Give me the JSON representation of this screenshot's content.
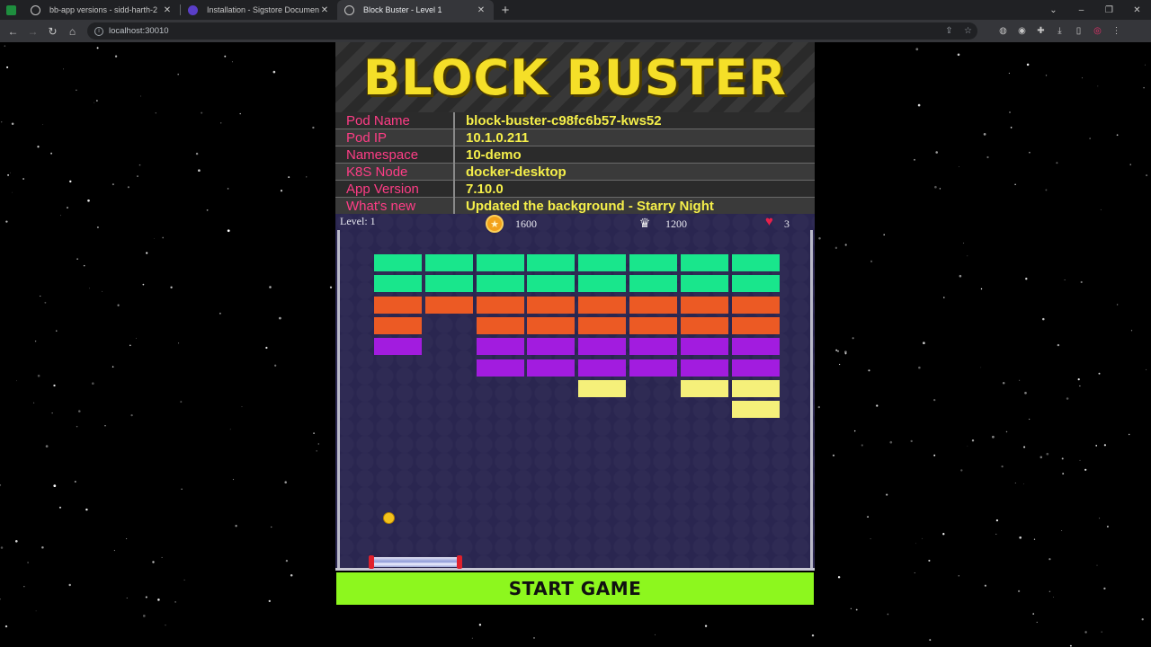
{
  "browser": {
    "tabs": [
      {
        "title": "bb-app versions - sidd-harth-2",
        "icon": "github-icon",
        "active": false
      },
      {
        "title": "Installation - Sigstore Document",
        "icon": "sigstore-icon",
        "active": false
      },
      {
        "title": "Block Buster - Level 1",
        "icon": "globe-icon",
        "active": true
      }
    ],
    "url": "localhost:30010"
  },
  "game": {
    "title": "BLOCK BUSTER",
    "info": [
      {
        "key": "Pod Name",
        "value": "block-buster-c98fc6b57-kws52"
      },
      {
        "key": "Pod IP",
        "value": "10.1.0.211"
      },
      {
        "key": "Namespace",
        "value": "10-demo"
      },
      {
        "key": "K8S Node",
        "value": "docker-desktop"
      },
      {
        "key": "App Version",
        "value": "7.10.0"
      },
      {
        "key": "What's new",
        "value": "Updated the background - Starry Night"
      }
    ],
    "hud": {
      "level": "Level: 1",
      "score": "1600",
      "hiscore": "1200",
      "lives": "3"
    },
    "start_label": "START GAME",
    "colors": {
      "green": "#19e68c",
      "orange": "#ec5a24",
      "purple": "#a21cdf",
      "yellow": "#f5f07a",
      "start": "#8df71e",
      "title": "#f5df28",
      "key": "#ff3d86"
    },
    "bricks": [
      {
        "row": 0,
        "cols": [
          0,
          1,
          2,
          3,
          4,
          5,
          6,
          7
        ],
        "color": "green"
      },
      {
        "row": 1,
        "cols": [
          0,
          1,
          2,
          3,
          4,
          5,
          6,
          7
        ],
        "color": "green"
      },
      {
        "row": 2,
        "cols": [
          0,
          1,
          2,
          3,
          4,
          5,
          6,
          7
        ],
        "color": "orange"
      },
      {
        "row": 3,
        "cols": [
          0,
          2,
          3,
          4,
          5,
          6,
          7
        ],
        "color": "orange"
      },
      {
        "row": 4,
        "cols": [
          0,
          2,
          3,
          4,
          5,
          6,
          7
        ],
        "color": "purple"
      },
      {
        "row": 5,
        "cols": [
          2,
          3,
          4,
          5,
          6,
          7
        ],
        "color": "purple"
      },
      {
        "row": 6,
        "cols": [
          4,
          6,
          7
        ],
        "color": "yellow"
      },
      {
        "row": 7,
        "cols": [
          7
        ],
        "color": "yellow"
      }
    ]
  }
}
